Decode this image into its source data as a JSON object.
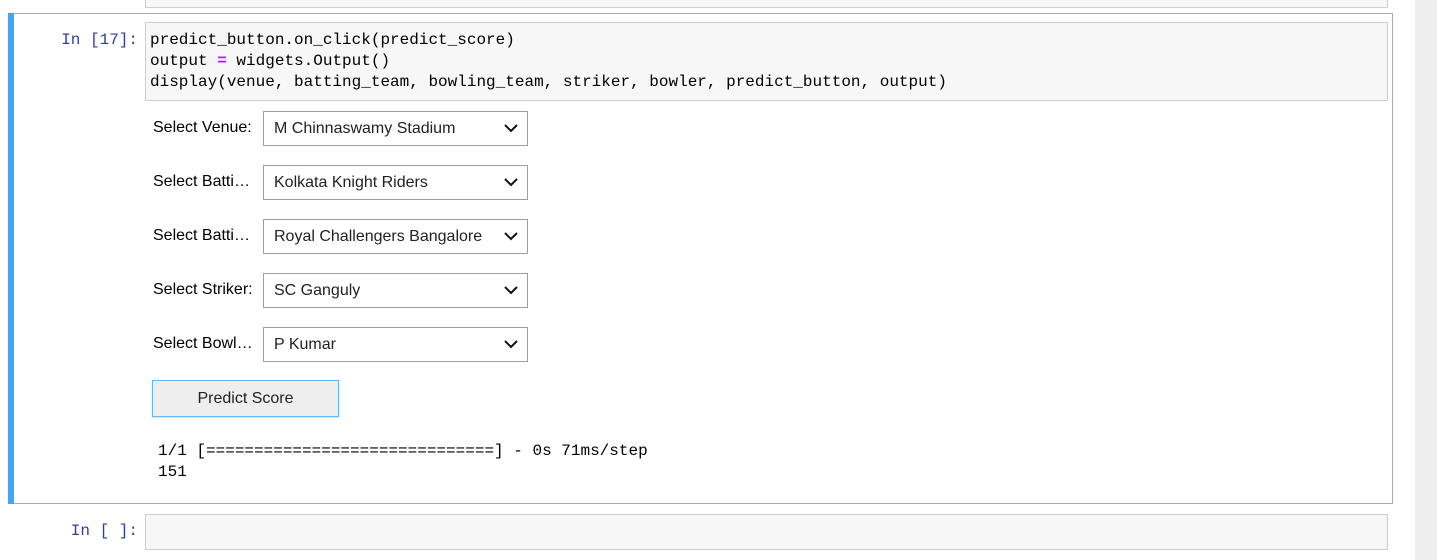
{
  "cells": {
    "active": {
      "prompt": "In [17]:",
      "code": {
        "line1": "predict_button.on_click(predict_score)",
        "line2_pre": "output ",
        "line2_op": "=",
        "line2_post": " widgets.Output()",
        "line3": "display(venue, batting_team, bowling_team, striker, bowler, predict_button, output)"
      },
      "widgets": [
        {
          "label": "Select Venue:",
          "value": "M Chinnaswamy Stadium"
        },
        {
          "label": "Select Batting Team:",
          "value": "Kolkata Knight Riders"
        },
        {
          "label": "Select Batting Team:",
          "value": "Royal Challengers Bangalore"
        },
        {
          "label": "Select Striker:",
          "value": "SC Ganguly"
        },
        {
          "label": "Select Bowler:",
          "value": "P Kumar"
        }
      ],
      "button_label": "Predict Score",
      "output": {
        "line1": "1/1 [==============================] - 0s 71ms/step",
        "line2": "151"
      }
    },
    "next": {
      "prompt": "In [ ]:"
    }
  },
  "colors": {
    "selected_bar": "#42a5f5",
    "prompt": "#303f9f",
    "operator": "#aa22ff"
  },
  "icons": [
    "chevron-down-icon"
  ]
}
